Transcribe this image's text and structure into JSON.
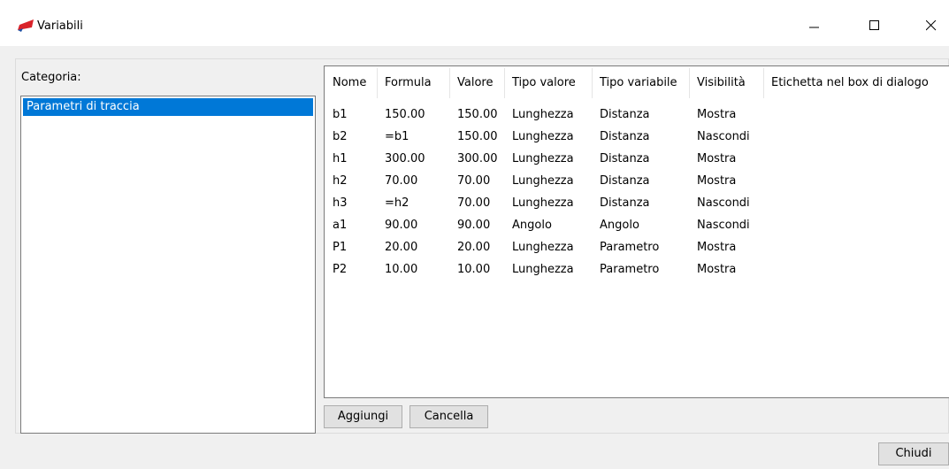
{
  "window": {
    "title": "Variabili"
  },
  "category": {
    "label": "Categoria:",
    "items": [
      "Parametri di traccia"
    ]
  },
  "table": {
    "headers": [
      "Nome",
      "Formula",
      "Valore",
      "Tipo valore",
      "Tipo variabile",
      "Visibilità",
      "Etichetta nel box di dialogo"
    ],
    "rows": [
      [
        "b1",
        "150.00",
        "150.00",
        "Lunghezza",
        "Distanza",
        "Mostra",
        ""
      ],
      [
        "b2",
        "=b1",
        "150.00",
        "Lunghezza",
        "Distanza",
        "Nascondi",
        ""
      ],
      [
        "h1",
        "300.00",
        "300.00",
        "Lunghezza",
        "Distanza",
        "Mostra",
        ""
      ],
      [
        "h2",
        "70.00",
        "70.00",
        "Lunghezza",
        "Distanza",
        "Mostra",
        ""
      ],
      [
        "h3",
        "=h2",
        "70.00",
        "Lunghezza",
        "Distanza",
        "Nascondi",
        ""
      ],
      [
        "a1",
        "90.00",
        "90.00",
        "Angolo",
        "Angolo",
        "Nascondi",
        ""
      ],
      [
        "P1",
        "20.00",
        "20.00",
        "Lunghezza",
        "Parametro",
        "Mostra",
        ""
      ],
      [
        "P2",
        "10.00",
        "10.00",
        "Lunghezza",
        "Parametro",
        "Mostra",
        ""
      ]
    ]
  },
  "buttons": {
    "add": "Aggiungi",
    "delete": "Cancella",
    "close": "Chiudi"
  },
  "colors": {
    "selection": "#0078d7",
    "app_icon_red": "#d9232a",
    "app_icon_blue": "#1f4fa3"
  },
  "icons": {
    "app": "app-logo-icon",
    "minimize": "minimize-icon",
    "maximize": "maximize-icon",
    "close": "close-icon"
  }
}
